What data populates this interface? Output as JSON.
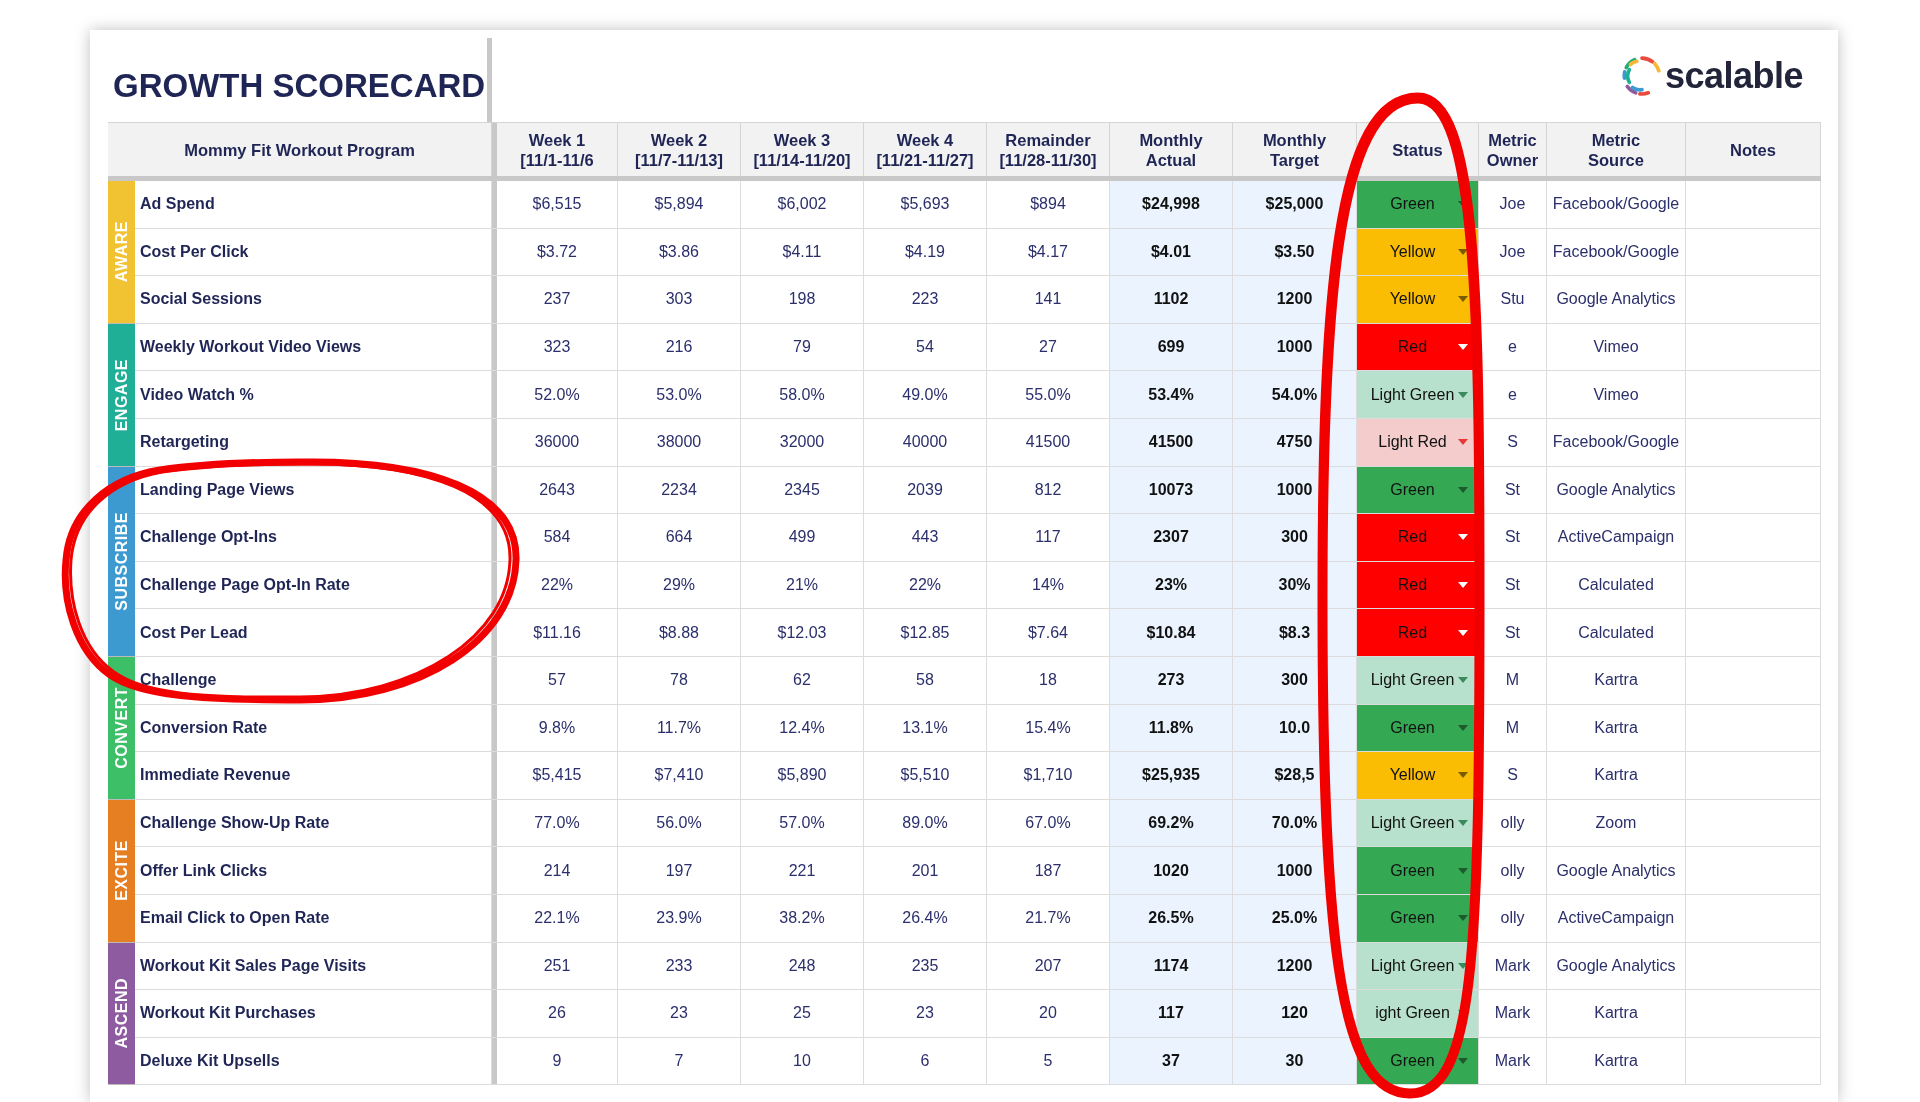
{
  "title": "GROWTH SCORECARD",
  "logo": {
    "text": "scalable"
  },
  "table": {
    "columns": [
      "Mommy Fit Workout Program",
      "Week 1\n[11/1-11/6",
      "Week 2\n[11/7-11/13]",
      "Week 3\n[11/14-11/20]",
      "Week 4\n[11/21-11/27]",
      "Remainder\n[11/28-11/30]",
      "Monthly\nActual",
      "Monthly\nTarget",
      "Status",
      "Metric\nOwner",
      "Metric\nSource",
      "Notes"
    ],
    "groups": [
      {
        "label": "AWARE",
        "color": "#f1c232",
        "rows": [
          {
            "metric": "Ad Spend",
            "values": [
              "$6,515",
              "$5,894",
              "$6,002",
              "$5,693",
              "$894",
              "$24,998",
              "$25,000"
            ],
            "status": {
              "label": "Green",
              "kind": "green"
            },
            "owner": "Joe",
            "source": "Facebook/Google"
          },
          {
            "metric": "Cost Per Click",
            "values": [
              "$3.72",
              "$3.86",
              "$4.11",
              "$4.19",
              "$4.17",
              "$4.01",
              "$3.50"
            ],
            "status": {
              "label": "Yellow",
              "kind": "yellow"
            },
            "owner": "Joe",
            "source": "Facebook/Google"
          },
          {
            "metric": "Social Sessions",
            "values": [
              "237",
              "303",
              "198",
              "223",
              "141",
              "1102",
              "1200"
            ],
            "status": {
              "label": "Yellow",
              "kind": "yellow"
            },
            "owner": "Stu",
            "source": "Google Analytics"
          }
        ]
      },
      {
        "label": "ENGAGE",
        "color": "#1fae96",
        "rows": [
          {
            "metric": "Weekly Workout Video Views",
            "values": [
              "323",
              "216",
              "79",
              "54",
              "27",
              "699",
              "1000"
            ],
            "status": {
              "label": "Red",
              "kind": "red"
            },
            "owner": "e",
            "source": "Vimeo"
          },
          {
            "metric": "Video Watch %",
            "values": [
              "52.0%",
              "53.0%",
              "58.0%",
              "49.0%",
              "55.0%",
              "53.4%",
              "54.0%"
            ],
            "status": {
              "label": "Light Green",
              "kind": "light_green"
            },
            "owner": "e",
            "source": "Vimeo"
          },
          {
            "metric": "Retargeting",
            "values": [
              "36000",
              "38000",
              "32000",
              "40000",
              "41500",
              "41500",
              "4750"
            ],
            "status": {
              "label": "Light Red",
              "kind": "light_red"
            },
            "owner": "S",
            "source": "Facebook/Google"
          }
        ]
      },
      {
        "label": "SUBSCRIBE",
        "color": "#3d9ad1",
        "rows": [
          {
            "metric": "Landing Page Views",
            "values": [
              "2643",
              "2234",
              "2345",
              "2039",
              "812",
              "10073",
              "1000"
            ],
            "status": {
              "label": "Green",
              "kind": "green"
            },
            "owner": "St",
            "source": "Google Analytics"
          },
          {
            "metric": "Challenge Opt-Ins",
            "values": [
              "584",
              "664",
              "499",
              "443",
              "117",
              "2307",
              "300"
            ],
            "status": {
              "label": "Red",
              "kind": "red"
            },
            "owner": "St",
            "source": "ActiveCampaign"
          },
          {
            "metric": "Challenge Page Opt-In Rate",
            "values": [
              "22%",
              "29%",
              "21%",
              "22%",
              "14%",
              "23%",
              "30%"
            ],
            "status": {
              "label": "Red",
              "kind": "red"
            },
            "owner": "St",
            "source": "Calculated"
          },
          {
            "metric": "Cost Per Lead",
            "values": [
              "$11.16",
              "$8.88",
              "$12.03",
              "$12.85",
              "$7.64",
              "$10.84",
              "$8.3"
            ],
            "status": {
              "label": "Red",
              "kind": "red"
            },
            "owner": "St",
            "source": "Calculated"
          }
        ]
      },
      {
        "label": "CONVERT",
        "color": "#3cbf67",
        "rows": [
          {
            "metric": "Challenge",
            "values": [
              "57",
              "78",
              "62",
              "58",
              "18",
              "273",
              "300"
            ],
            "status": {
              "label": "Light Green",
              "kind": "light_green"
            },
            "owner": "M",
            "source": "Kartra"
          },
          {
            "metric": "Conversion Rate",
            "values": [
              "9.8%",
              "11.7%",
              "12.4%",
              "13.1%",
              "15.4%",
              "11.8%",
              "10.0"
            ],
            "status": {
              "label": "Green",
              "kind": "green"
            },
            "owner": "M",
            "source": "Kartra"
          },
          {
            "metric": "Immediate Revenue",
            "values": [
              "$5,415",
              "$7,410",
              "$5,890",
              "$5,510",
              "$1,710",
              "$25,935",
              "$28,5"
            ],
            "status": {
              "label": "Yellow",
              "kind": "yellow"
            },
            "owner": "S",
            "source": "Kartra"
          }
        ]
      },
      {
        "label": "EXCITE",
        "color": "#e67e22",
        "rows": [
          {
            "metric": "Challenge Show-Up Rate",
            "values": [
              "77.0%",
              "56.0%",
              "57.0%",
              "89.0%",
              "67.0%",
              "69.2%",
              "70.0%"
            ],
            "status": {
              "label": "Light Green",
              "kind": "light_green"
            },
            "owner": "olly",
            "source": "Zoom"
          },
          {
            "metric": "Offer Link Clicks",
            "values": [
              "214",
              "197",
              "221",
              "201",
              "187",
              "1020",
              "1000"
            ],
            "status": {
              "label": "Green",
              "kind": "green"
            },
            "owner": "olly",
            "source": "Google Analytics"
          },
          {
            "metric": "Email Click to Open Rate",
            "values": [
              "22.1%",
              "23.9%",
              "38.2%",
              "26.4%",
              "21.7%",
              "26.5%",
              "25.0%"
            ],
            "status": {
              "label": "Green",
              "kind": "green"
            },
            "owner": "olly",
            "source": "ActiveCampaign"
          }
        ]
      },
      {
        "label": "ASCEND",
        "color": "#8e5aa0",
        "rows": [
          {
            "metric": "Workout Kit Sales Page Visits",
            "values": [
              "251",
              "233",
              "248",
              "235",
              "207",
              "1174",
              "1200"
            ],
            "status": {
              "label": "Light Green",
              "kind": "light_green"
            },
            "owner": "Mark",
            "source": "Google Analytics"
          },
          {
            "metric": "Workout Kit Purchases",
            "values": [
              "26",
              "23",
              "25",
              "23",
              "20",
              "117",
              "120"
            ],
            "status": {
              "label": "ight Green",
              "kind": "light_green"
            },
            "owner": "Mark",
            "source": "Kartra"
          },
          {
            "metric": "Deluxe Kit Upsells",
            "values": [
              "9",
              "7",
              "10",
              "6",
              "5",
              "37",
              "30"
            ],
            "status": {
              "label": "Green",
              "kind": "green"
            },
            "owner": "Mark",
            "source": "Kartra"
          }
        ]
      }
    ]
  }
}
